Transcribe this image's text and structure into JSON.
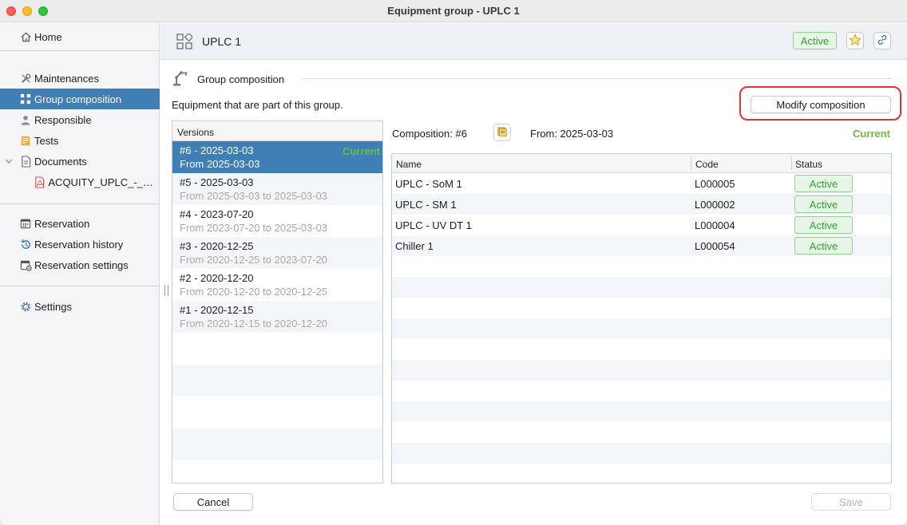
{
  "window": {
    "title": "Equipment group - UPLC 1"
  },
  "sidebar": {
    "items": [
      {
        "label": "Home",
        "icon": "home-icon"
      },
      {
        "label": "Maintenances",
        "icon": "tools-icon"
      },
      {
        "label": "Group composition",
        "icon": "grid-icon",
        "selected": true
      },
      {
        "label": "Responsible",
        "icon": "person-icon"
      },
      {
        "label": "Tests",
        "icon": "tests-icon"
      },
      {
        "label": "Documents",
        "icon": "document-icon"
      },
      {
        "label": "ACQUITY_UPLC_-_Us...",
        "icon": "pdf-icon"
      },
      {
        "label": "Reservation",
        "icon": "calendar-icon"
      },
      {
        "label": "Reservation history",
        "icon": "history-icon"
      },
      {
        "label": "Reservation settings",
        "icon": "calendar-settings-icon"
      },
      {
        "label": "Settings",
        "icon": "gear-icon"
      }
    ]
  },
  "header": {
    "title": "UPLC 1",
    "status": "Active"
  },
  "section": {
    "title": "Group composition",
    "description": "Equipment that are part of this group.",
    "modify_button": "Modify composition"
  },
  "versions": {
    "header": "Versions",
    "items": [
      {
        "title": "#6 - 2025-03-03",
        "subtitle": "From 2025-03-03",
        "tag": "Current",
        "selected": true
      },
      {
        "title": "#5 - 2025-03-03",
        "subtitle": "From 2025-03-03 to 2025-03-03"
      },
      {
        "title": "#4 - 2023-07-20",
        "subtitle": "From 2023-07-20 to 2025-03-03"
      },
      {
        "title": "#3 - 2020-12-25",
        "subtitle": "From 2020-12-25 to 2023-07-20"
      },
      {
        "title": "#2 - 2020-12-20",
        "subtitle": "From 2020-12-20 to 2020-12-25"
      },
      {
        "title": "#1 - 2020-12-15",
        "subtitle": "From 2020-12-15 to 2020-12-20"
      }
    ]
  },
  "composition": {
    "label": "Composition: #6",
    "from": "From: 2025-03-03",
    "current": "Current",
    "columns": [
      "Name",
      "Code",
      "Status"
    ],
    "rows": [
      {
        "name": "UPLC - SoM 1",
        "code": "L000005",
        "status": "Active"
      },
      {
        "name": "UPLC - SM 1",
        "code": "L000002",
        "status": "Active"
      },
      {
        "name": "UPLC - UV DT 1",
        "code": "L000004",
        "status": "Active"
      },
      {
        "name": "Chiller 1",
        "code": "L000054",
        "status": "Active"
      }
    ]
  },
  "footer": {
    "cancel": "Cancel",
    "save": "Save"
  },
  "colors": {
    "accent": "#3f7fb6",
    "current": "#6bbf3a",
    "active_bg": "#e6f6e6",
    "highlight": "#e0323a"
  }
}
